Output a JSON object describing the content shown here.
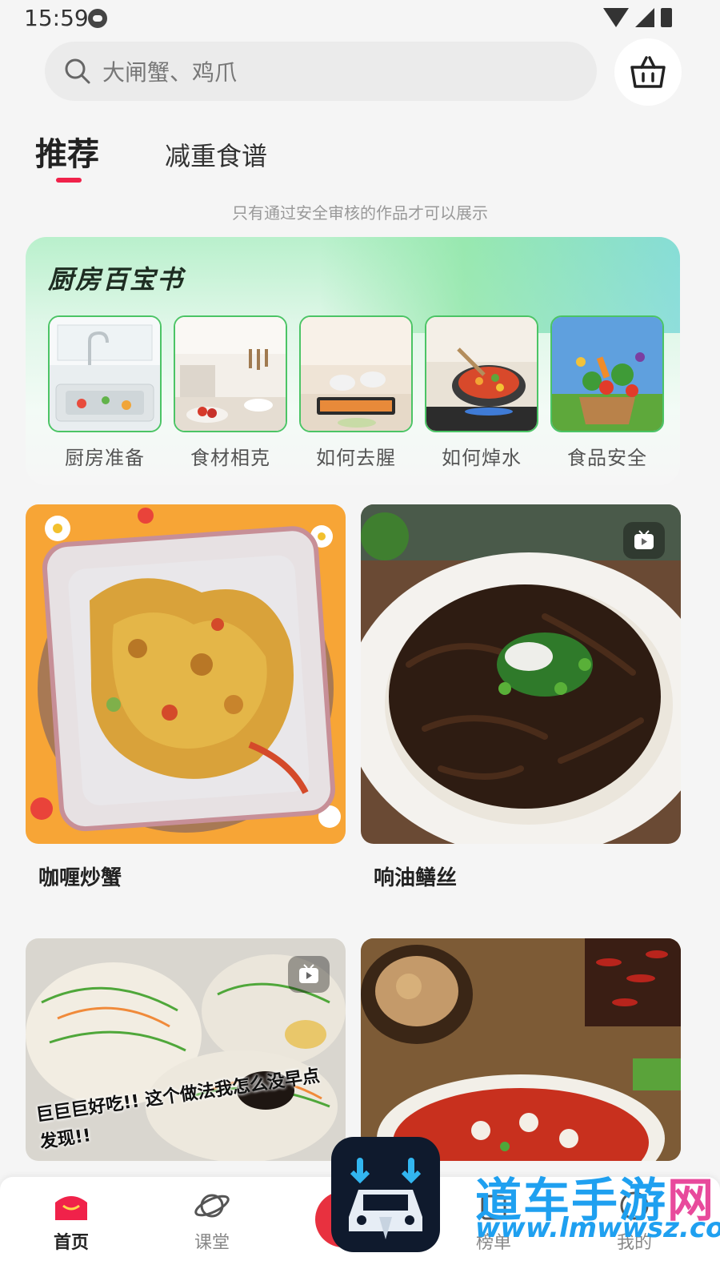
{
  "status_bar": {
    "time": "15:59"
  },
  "search": {
    "placeholder": "大闸蟹、鸡爪"
  },
  "tabs": [
    {
      "label": "推荐",
      "active": true
    },
    {
      "label": "减重食谱",
      "active": false
    }
  ],
  "notice": "只有通过安全审核的作品才可以展示",
  "kitchen": {
    "title": "厨房百宝书",
    "items": [
      {
        "label": "厨房准备"
      },
      {
        "label": "食材相克"
      },
      {
        "label": "如何去腥"
      },
      {
        "label": "如何焯水"
      },
      {
        "label": "食品安全"
      }
    ]
  },
  "recipes": [
    {
      "title": "咖喱炒蟹",
      "video": false
    },
    {
      "title": "响油鳝丝",
      "video": true
    },
    {
      "title": "",
      "video": true,
      "image_text": "巨巨巨好吃!! 这个做法我怎么没早点发现!!"
    },
    {
      "title": "",
      "video": false
    }
  ],
  "bottom_nav": [
    {
      "label": "首页",
      "active": true
    },
    {
      "label": "课堂",
      "active": false
    },
    {
      "label": "榜单",
      "active": false
    },
    {
      "label": "我的",
      "active": false
    }
  ],
  "watermark": {
    "name_blue": "道车手游",
    "name_pink": "网",
    "url": "www.lmwwsz.com"
  },
  "colors": {
    "accent": "#f0224a",
    "kitchen_border": "#4bc465",
    "background": "#f5f5f5"
  }
}
